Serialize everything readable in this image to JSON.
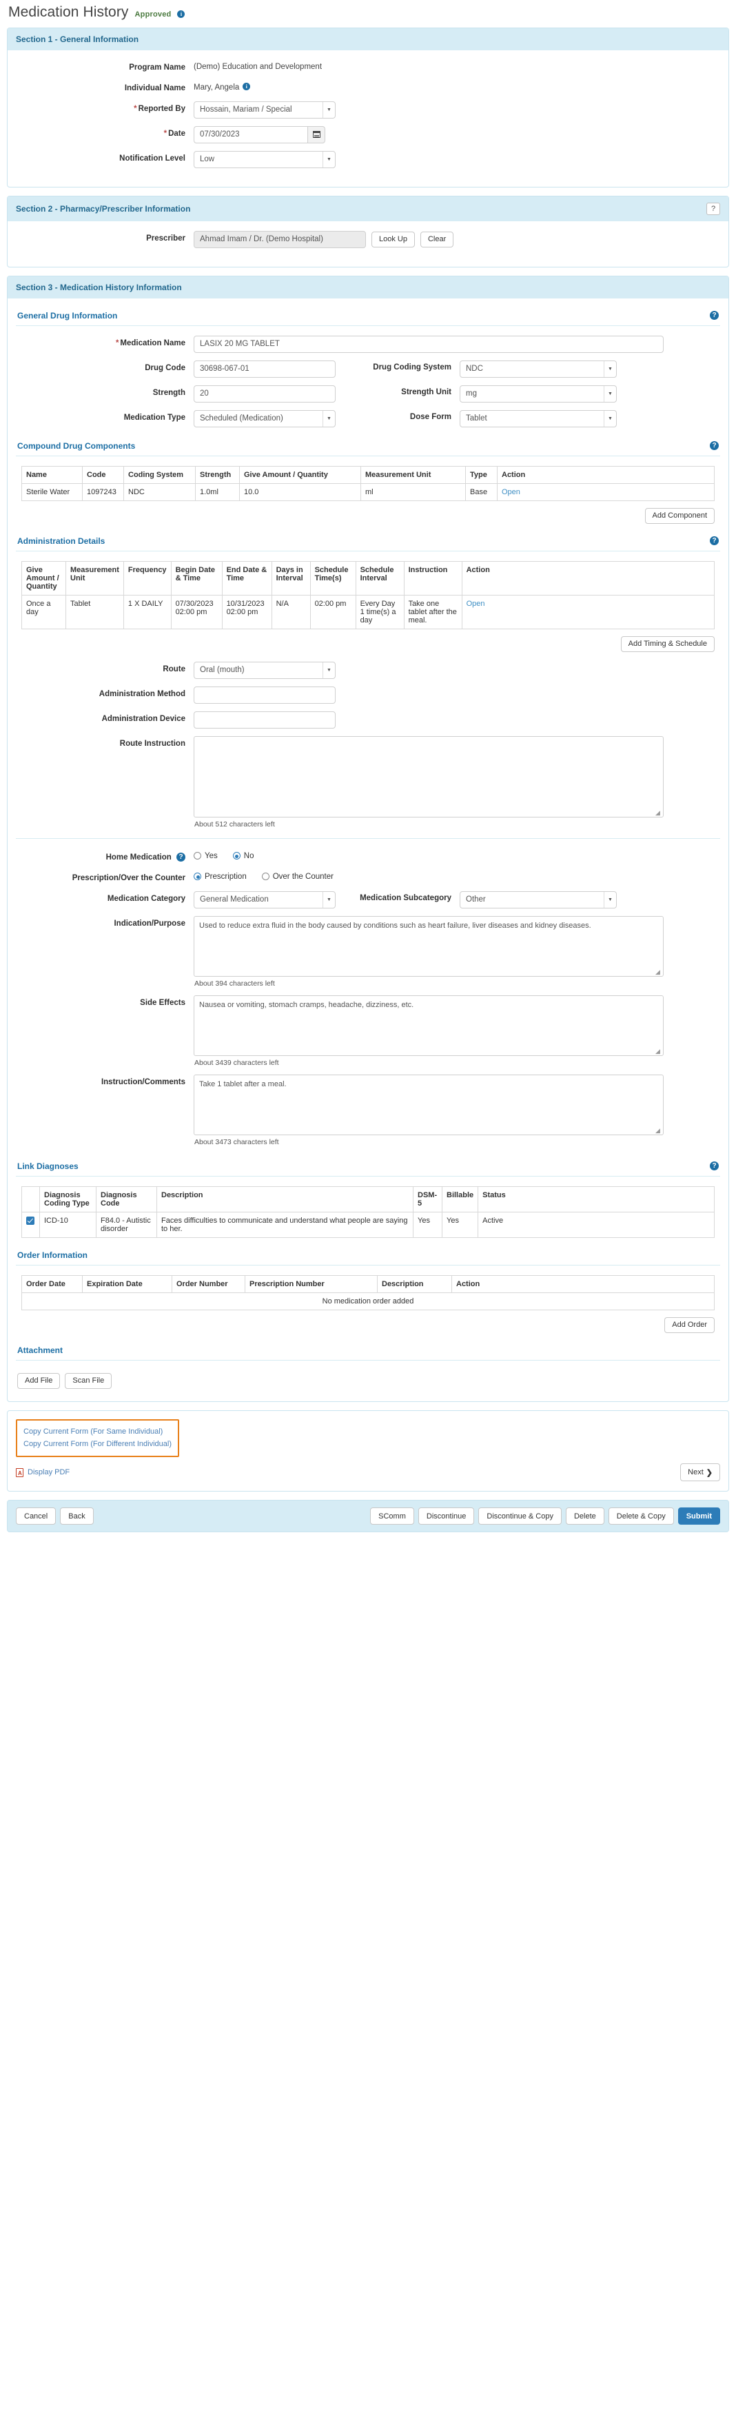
{
  "page": {
    "title": "Medication History",
    "status": "Approved"
  },
  "section1": {
    "heading": "Section 1 - General Information",
    "fields": {
      "program_name_label": "Program Name",
      "program_name_value": "(Demo) Education and Development",
      "individual_name_label": "Individual Name",
      "individual_name_value": "Mary, Angela",
      "reported_by_label": "Reported By",
      "reported_by_value": "Hossain, Mariam / Special",
      "date_label": "Date",
      "date_value": "07/30/2023",
      "notification_level_label": "Notification Level",
      "notification_level_value": "Low"
    }
  },
  "section2": {
    "heading": "Section 2 - Pharmacy/Prescriber Information",
    "help_label": "?",
    "prescriber_label": "Prescriber",
    "prescriber_value": "Ahmad Imam / Dr. (Demo Hospital)",
    "look_up_label": "Look Up",
    "clear_label": "Clear"
  },
  "section3": {
    "heading": "Section 3 - Medication History Information",
    "general_drug": {
      "heading": "General Drug Information",
      "medication_name_label": "Medication Name",
      "medication_name_value": "LASIX 20 MG TABLET",
      "drug_code_label": "Drug Code",
      "drug_code_value": "30698-067-01",
      "drug_coding_system_label": "Drug Coding System",
      "drug_coding_system_value": "NDC",
      "strength_label": "Strength",
      "strength_value": "20",
      "strength_unit_label": "Strength Unit",
      "strength_unit_value": "mg",
      "medication_type_label": "Medication Type",
      "medication_type_value": "Scheduled (Medication)",
      "dose_form_label": "Dose Form",
      "dose_form_value": "Tablet"
    },
    "compound": {
      "heading": "Compound Drug Components",
      "columns": [
        "Name",
        "Code",
        "Coding System",
        "Strength",
        "Give Amount / Quantity",
        "Measurement Unit",
        "Type",
        "Action"
      ],
      "rows": [
        {
          "name": "Sterile Water",
          "code": "1097243",
          "coding_system": "NDC",
          "strength": "1.0ml",
          "give_amount": "10.0",
          "measurement_unit": "ml",
          "type": "Base",
          "action": "Open"
        }
      ],
      "add_button": "Add Component"
    },
    "administration": {
      "heading": "Administration Details",
      "columns": [
        "Give Amount / Quantity",
        "Measurement Unit",
        "Frequency",
        "Begin Date & Time",
        "End Date & Time",
        "Days in Interval",
        "Schedule Time(s)",
        "Schedule Interval",
        "Instruction",
        "Action"
      ],
      "rows": [
        {
          "give_amount": "Once a day",
          "measurement_unit": "Tablet",
          "frequency": "1 X DAILY",
          "begin_datetime": "07/30/2023 02:00 pm",
          "end_datetime": "10/31/2023 02:00 pm",
          "days_in_interval": "N/A",
          "schedule_times": "02:00 pm",
          "schedule_interval": "Every Day 1 time(s) a day",
          "instruction": "Take one tablet after the meal.",
          "action": "Open"
        }
      ],
      "add_button": "Add Timing & Schedule"
    },
    "route_label": "Route",
    "route_value": "Oral (mouth)",
    "administration_method_label": "Administration Method",
    "administration_method_value": "",
    "administration_device_label": "Administration Device",
    "administration_device_value": "",
    "route_instruction_label": "Route Instruction",
    "route_instruction_value": "",
    "route_instruction_chars": "About 512 characters left",
    "home_medication_label": "Home Medication",
    "home_medication_yes": "Yes",
    "home_medication_no": "No",
    "home_medication_selected": "No",
    "prescription_otc_label": "Prescription/Over the Counter",
    "prescription_option": "Prescription",
    "otc_option": "Over the Counter",
    "prescription_otc_selected": "Prescription",
    "medication_category_label": "Medication Category",
    "medication_category_value": "General Medication",
    "medication_subcategory_label": "Medication Subcategory",
    "medication_subcategory_value": "Other",
    "indication_label": "Indication/Purpose",
    "indication_value": "Used to reduce extra fluid in the body caused by conditions such as heart failure, liver diseases and kidney diseases.",
    "indication_chars": "About 394 characters left",
    "side_effects_label": "Side Effects",
    "side_effects_value": "Nausea or vomiting, stomach cramps, headache, dizziness, etc.",
    "side_effects_chars": "About 3439 characters left",
    "instruction_comments_label": "Instruction/Comments",
    "instruction_comments_value": "Take 1 tablet after a meal.",
    "instruction_comments_chars": "About 3473 characters left",
    "link_diagnoses": {
      "heading": "Link Diagnoses",
      "columns": [
        "",
        "Diagnosis Coding Type",
        "Diagnosis Code",
        "Description",
        "DSM-5",
        "Billable",
        "Status"
      ],
      "rows": [
        {
          "checked": true,
          "coding_type": "ICD-10",
          "code": "F84.0 - Autistic disorder",
          "description": "Faces difficulties to communicate and understand what people are saying to her.",
          "dsm5": "Yes",
          "billable": "Yes",
          "status": "Active"
        }
      ]
    },
    "order_information": {
      "heading": "Order Information",
      "columns": [
        "Order Date",
        "Expiration Date",
        "Order Number",
        "Prescription Number",
        "Description",
        "Action"
      ],
      "empty_message": "No medication order added",
      "add_button": "Add Order"
    },
    "attachment": {
      "heading": "Attachment",
      "add_file_label": "Add File",
      "scan_file_label": "Scan File"
    }
  },
  "copy_section": {
    "copy_same_individual": "Copy Current Form (For Same Individual)",
    "copy_different_individual": "Copy Current Form (For Different Individual)",
    "display_pdf": "Display PDF",
    "next_label": "Next"
  },
  "footer": {
    "cancel": "Cancel",
    "back": "Back",
    "scomm": "SComm",
    "discontinue": "Discontinue",
    "discontinue_copy": "Discontinue & Copy",
    "delete": "Delete",
    "delete_copy": "Delete & Copy",
    "submit": "Submit"
  }
}
